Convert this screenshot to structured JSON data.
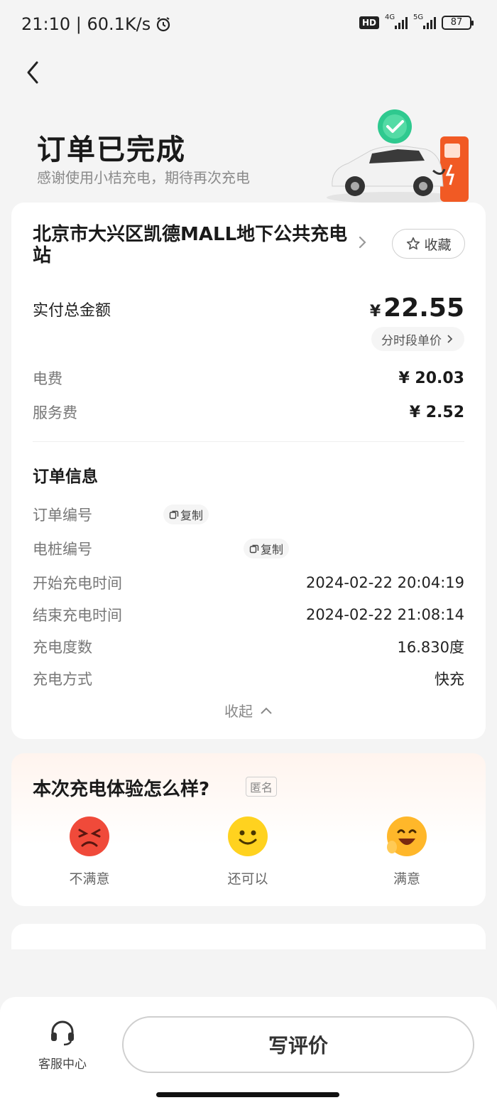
{
  "status_bar": {
    "time_speed": "21:10 | 60.1K/s",
    "hd": "HD",
    "net1": "4G",
    "net2": "5G",
    "battery": "87"
  },
  "header": {
    "title": "订单已完成",
    "subtitle": "感谢使用小桔充电，期待再次充电"
  },
  "station": {
    "name": "北京市大兴区凯德MALL地下公共充电站",
    "favorite_label": "收藏"
  },
  "payment": {
    "total_label": "实付总金额",
    "currency": "¥",
    "total_amount": "22.55",
    "price_chip_label": "分时段单价",
    "fees": [
      {
        "label": "电费",
        "value": "¥ 20.03"
      },
      {
        "label": "服务费",
        "value": "¥ 2.52"
      }
    ]
  },
  "order_info": {
    "title": "订单信息",
    "copy_label": "复制",
    "rows": [
      {
        "label": "订单编号",
        "value": ""
      },
      {
        "label": "电桩编号",
        "value": ""
      },
      {
        "label": "开始充电时间",
        "value": "2024-02-22 20:04:19"
      },
      {
        "label": "结束充电时间",
        "value": "2024-02-22 21:08:14"
      },
      {
        "label": "充电度数",
        "value": "16.830度"
      },
      {
        "label": "充电方式",
        "value": "快充"
      }
    ],
    "collapse_label": "收起"
  },
  "rating": {
    "title": "本次充电体验怎么样?",
    "anonymous_tag": "匿名",
    "options": [
      {
        "label": "不满意",
        "icon": "angry-face-icon"
      },
      {
        "label": "还可以",
        "icon": "smile-face-icon"
      },
      {
        "label": "满意",
        "icon": "happy-face-icon"
      }
    ]
  },
  "bottom_bar": {
    "service_label": "客服中心",
    "review_label": "写评价"
  },
  "colors": {
    "background": "#f4f4f4",
    "check_green": "#2fc98f",
    "charger_orange": "#f15a24",
    "face_red": "#f04a3a",
    "face_yellow": "#ffd21f",
    "face_orange": "#ffb72a"
  }
}
